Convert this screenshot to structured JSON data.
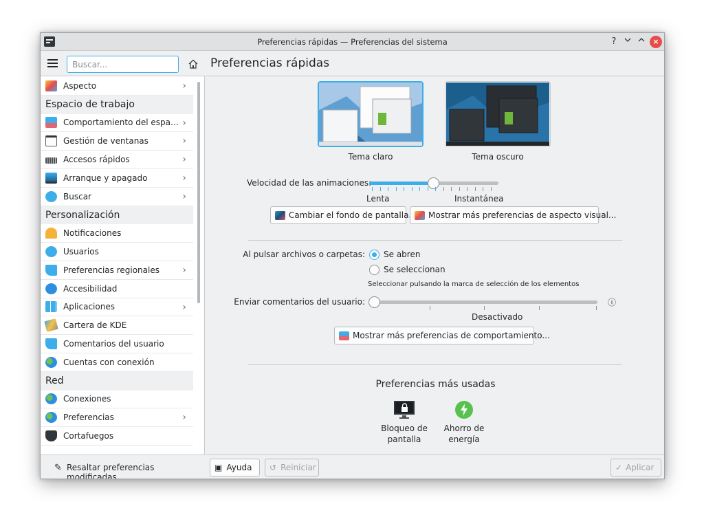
{
  "window": {
    "title": "Preferencias rápidas — Preferencias del sistema",
    "help": "?",
    "minimize": "⌄",
    "maximize": "⌃",
    "close": "×"
  },
  "sidebar": {
    "search": {
      "placeholder": "Buscar..."
    },
    "items": [
      {
        "type": "item",
        "label": "Aspecto",
        "icon": "aspect-icon",
        "chevron": true
      },
      {
        "type": "cat",
        "label": "Espacio de trabajo"
      },
      {
        "type": "item",
        "label": "Comportamiento del espacio de trabajo",
        "icon": "workspace-icon",
        "chevron": true
      },
      {
        "type": "item",
        "label": "Gestión de ventanas",
        "icon": "window-icon",
        "chevron": true
      },
      {
        "type": "item",
        "label": "Accesos rápidos",
        "icon": "keyboard-icon",
        "chevron": true
      },
      {
        "type": "item",
        "label": "Arranque y apagado",
        "icon": "monitor-icon",
        "chevron": true
      },
      {
        "type": "item",
        "label": "Buscar",
        "icon": "search-icon",
        "chevron": true
      },
      {
        "type": "cat",
        "label": "Personalización"
      },
      {
        "type": "item",
        "label": "Notificaciones",
        "icon": "bell-icon",
        "chevron": false
      },
      {
        "type": "item",
        "label": "Usuarios",
        "icon": "users-icon",
        "chevron": false
      },
      {
        "type": "item",
        "label": "Preferencias regionales",
        "icon": "regional-icon",
        "chevron": true
      },
      {
        "type": "item",
        "label": "Accesibilidad",
        "icon": "accessibility-icon",
        "chevron": false
      },
      {
        "type": "item",
        "label": "Aplicaciones",
        "icon": "apps-icon",
        "chevron": true
      },
      {
        "type": "item",
        "label": "Cartera de KDE",
        "icon": "wallet-icon",
        "chevron": false
      },
      {
        "type": "item",
        "label": "Comentarios del usuario",
        "icon": "feedback-icon",
        "chevron": false
      },
      {
        "type": "item",
        "label": "Cuentas con conexión",
        "icon": "globe-icon",
        "chevron": false
      },
      {
        "type": "cat",
        "label": "Red"
      },
      {
        "type": "item",
        "label": "Conexiones",
        "icon": "globe-icon",
        "chevron": false
      },
      {
        "type": "item",
        "label": "Preferencias",
        "icon": "globe-icon",
        "chevron": true
      },
      {
        "type": "item",
        "label": "Cortafuegos",
        "icon": "shield-icon",
        "chevron": false
      }
    ],
    "footer_label": "Resaltar preferencias modificadas"
  },
  "main": {
    "title": "Preferencias rápidas",
    "themes": [
      {
        "label": "Tema claro",
        "selected": true
      },
      {
        "label": "Tema oscuro",
        "selected": false
      }
    ],
    "animation": {
      "label": "Velocidad de las animaciones:",
      "min_label": "Lenta",
      "max_label": "Instantánea",
      "value": 0.5
    },
    "buttons": {
      "wallpaper": "Cambiar el fondo de pantalla...",
      "appearance": "Mostrar más preferencias de aspecto visual...",
      "behavior": "Mostrar más preferencias de comportamiento..."
    },
    "click": {
      "label": "Al pulsar archivos o carpetas:",
      "option_open": "Se abren",
      "option_select": "Se seleccionan",
      "hint": "Seleccionar pulsando la marca de selección de los elementos"
    },
    "feedback": {
      "label": "Enviar comentarios del usuario:",
      "value_label": "Desactivado",
      "info": "ⓘ"
    },
    "frequent": {
      "title": "Preferencias más usadas",
      "items": [
        {
          "label1": "Bloqueo de",
          "label2": "pantalla"
        },
        {
          "label1": "Ahorro de",
          "label2": "energía"
        }
      ]
    },
    "bottom": {
      "help": "Ayuda",
      "reset": "Reiniciar",
      "apply": "Aplicar"
    }
  },
  "colors": {
    "accent": "#3daee9",
    "window_bg": "#eff0f1",
    "close": "#e64c4c"
  }
}
